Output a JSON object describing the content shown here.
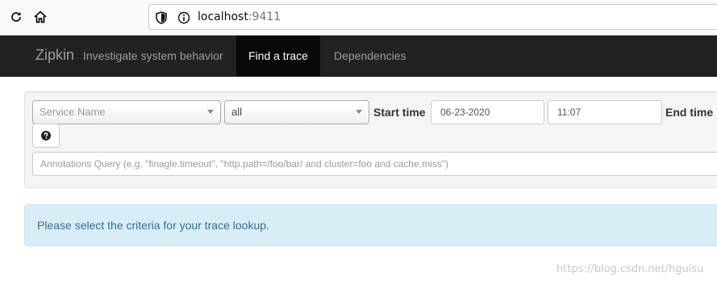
{
  "browser": {
    "url_host": "localhost",
    "url_port": ":9411"
  },
  "navbar": {
    "brand": "Zipkin",
    "tagline": "Investigate system behavior",
    "items": [
      {
        "label": "Find a trace",
        "active": true
      },
      {
        "label": "Dependencies",
        "active": false
      }
    ]
  },
  "search": {
    "service_placeholder": "Service Name",
    "span_value": "all",
    "start_time_label": "Start time",
    "start_date": "06-23-2020",
    "start_clock": "11:07",
    "end_time_label": "End time",
    "annotations_placeholder": "Annotations Query (e.g. \"finagle.timeout\", \"http.path=/foo/bar/ and cluster=foo and cache.miss\")"
  },
  "alert": {
    "message": "Please select the criteria for your trace lookup."
  },
  "watermark": "https://blog.csdn.net/hguisu"
}
